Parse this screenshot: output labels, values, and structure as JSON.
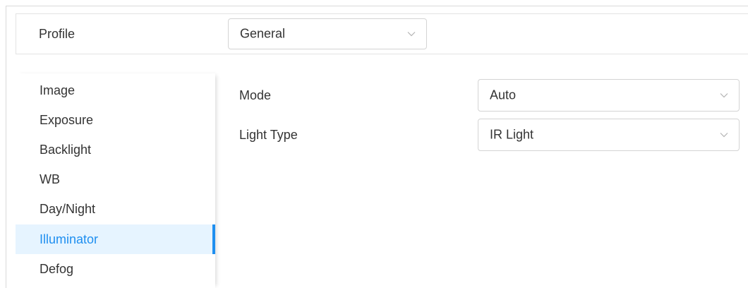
{
  "profile": {
    "label": "Profile",
    "selected": "General"
  },
  "sidebar": {
    "items": [
      {
        "label": "Image",
        "active": false
      },
      {
        "label": "Exposure",
        "active": false
      },
      {
        "label": "Backlight",
        "active": false
      },
      {
        "label": "WB",
        "active": false
      },
      {
        "label": "Day/Night",
        "active": false
      },
      {
        "label": "Illuminator",
        "active": true
      },
      {
        "label": "Defog",
        "active": false
      }
    ]
  },
  "form": {
    "mode": {
      "label": "Mode",
      "value": "Auto"
    },
    "light_type": {
      "label": "Light Type",
      "value": "IR Light"
    }
  },
  "colors": {
    "accent": "#1f8ff0",
    "active_background": "#e6f4ff",
    "border": "#d4d4d4"
  },
  "icons": {
    "dropdown": "chevron-down-icon"
  }
}
